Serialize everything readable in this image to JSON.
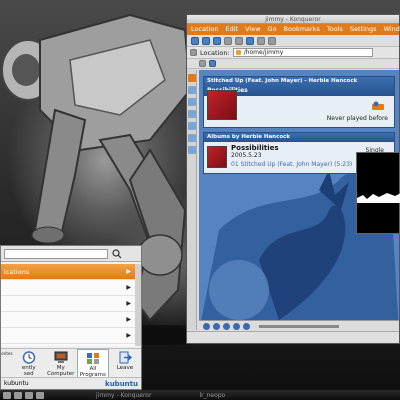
{
  "konqueror": {
    "title": "jimmy - Konqueror",
    "menu": [
      "Location",
      "Edit",
      "View",
      "Go",
      "Bookmarks",
      "Tools",
      "Settings",
      "Window"
    ],
    "location_label": "Location:",
    "location_value": "/home/jimmy",
    "now_playing": {
      "header": "Stitched Up (Feat. John Mayer) - Herbie Hancock",
      "album": "Possibilities",
      "status": "Never played before"
    },
    "albums": {
      "header": "Albums by Herbie Hancock",
      "album": "Possibilities",
      "date": "2005.5.23",
      "type": "Single",
      "track": "01 Stitched Up (Feat. John Mayer) (5:23)"
    }
  },
  "kickoff": {
    "first_item": "ications",
    "tabs": [
      {
        "label": "orites",
        "icon": "star-icon"
      },
      {
        "label": "ently\nsed",
        "icon": "clock-icon"
      },
      {
        "label": "My\nComputer",
        "icon": "computer-icon"
      },
      {
        "label": "All\nPrograms",
        "icon": "grid-icon"
      },
      {
        "label": "Leave",
        "icon": "leave-icon"
      }
    ],
    "footer_user": "kubuntu",
    "brand": "kubuntu"
  },
  "taskbar": {
    "konqueror_task": "jimmy - Konqueror",
    "other_task": "lr_neopo"
  },
  "colors": {
    "accent": "#e07b1c",
    "panel_blue": "#2a4f86",
    "kubuntu_blue": "#1e5fb3"
  }
}
